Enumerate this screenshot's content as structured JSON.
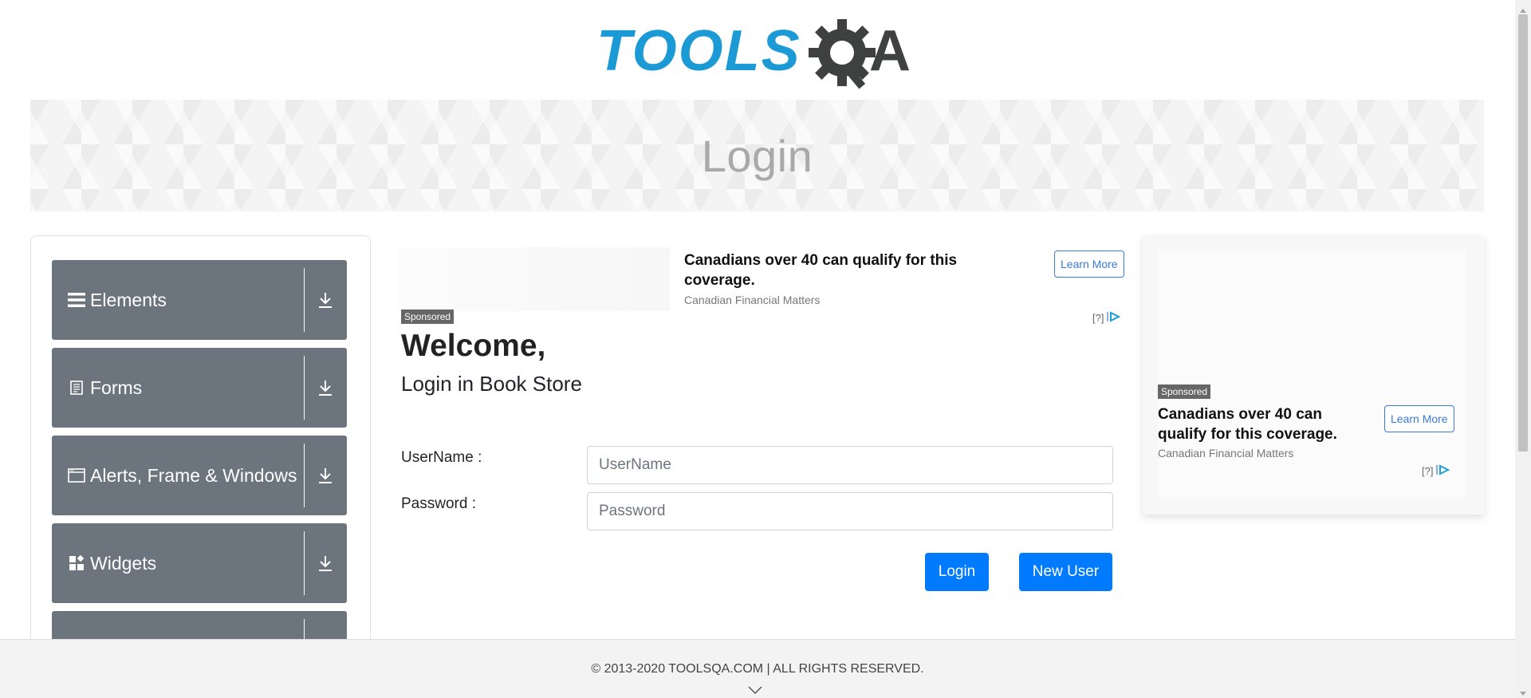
{
  "brand": {
    "logo_text_left": "TOOLS",
    "logo_text_right": "A",
    "logo_color": "#1b9ad6",
    "logo_dark": "#3f4141"
  },
  "banner": {
    "title": "Login"
  },
  "menu": {
    "groups": [
      {
        "label": "Elements",
        "icon": "hamburger-icon"
      },
      {
        "label": "Forms",
        "icon": "document-icon"
      },
      {
        "label": "Alerts, Frame & Windows",
        "icon": "window-icon"
      },
      {
        "label": "Widgets",
        "icon": "widgets-icon"
      },
      {
        "label": "",
        "icon": ""
      }
    ]
  },
  "top_ad": {
    "sponsored": "Sponsored",
    "title": "Canadians over 40 can qualify for this coverage.",
    "source": "Canadian Financial Matters",
    "cta": "Learn More",
    "info": "[?]"
  },
  "side_ad": {
    "sponsored": "Sponsored",
    "title": "Canadians over 40 can qualify for this coverage.",
    "source": "Canadian Financial Matters",
    "cta": "Learn More",
    "info": "[?]"
  },
  "form": {
    "welcome": "Welcome,",
    "subtitle": "Login in Book Store",
    "username_label": "UserName :",
    "username_placeholder": "UserName",
    "username_value": "",
    "password_label": "Password :",
    "password_placeholder": "Password",
    "password_value": "",
    "login_button": "Login",
    "new_user_button": "New User"
  },
  "footer": {
    "text": "© 2013-2020 TOOLSQA.COM | ALL RIGHTS RESERVED."
  },
  "colors": {
    "primary": "#007bff",
    "menu_bg": "#6c757d",
    "ad_blue": "#3a79d6"
  }
}
